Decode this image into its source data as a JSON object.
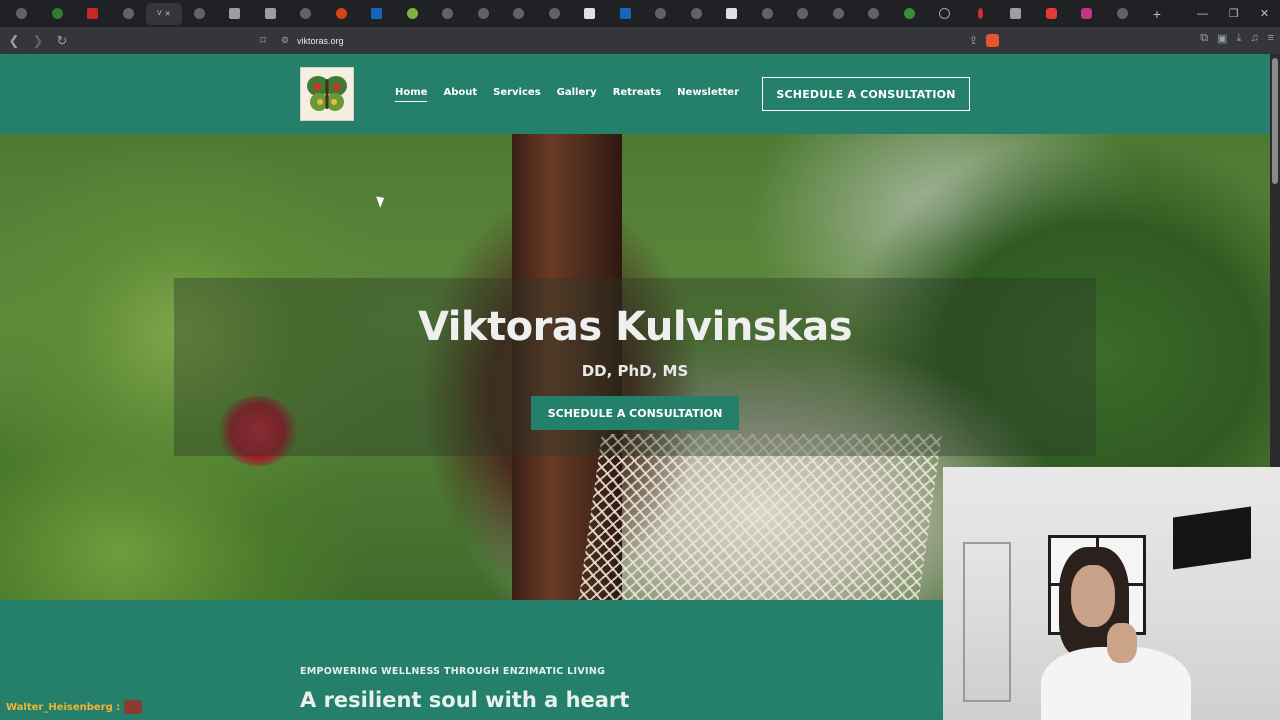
{
  "browser": {
    "tab_count": 33,
    "address": "viktoras.org",
    "window_controls": [
      "—",
      "❐",
      "✕"
    ]
  },
  "site": {
    "nav": {
      "links": [
        "Home",
        "About",
        "Services",
        "Gallery",
        "Retreats",
        "Newsletter"
      ],
      "active": "Home",
      "cta": "SCHEDULE A CONSULTATION"
    },
    "hero": {
      "title": "Viktoras Kulvinskas",
      "subtitle": "DD, PhD, MS",
      "cta": "SCHEDULE A CONSULTATION"
    },
    "section": {
      "eyebrow": "EMPOWERING WELLNESS THROUGH ENZIMATIC LIVING",
      "heading": "A resilient soul with a heart"
    },
    "colors": {
      "brand_green": "#24806a",
      "browser_dark": "#202124"
    }
  },
  "overlay": {
    "chat_user": "Walter_Heisenberg :"
  }
}
